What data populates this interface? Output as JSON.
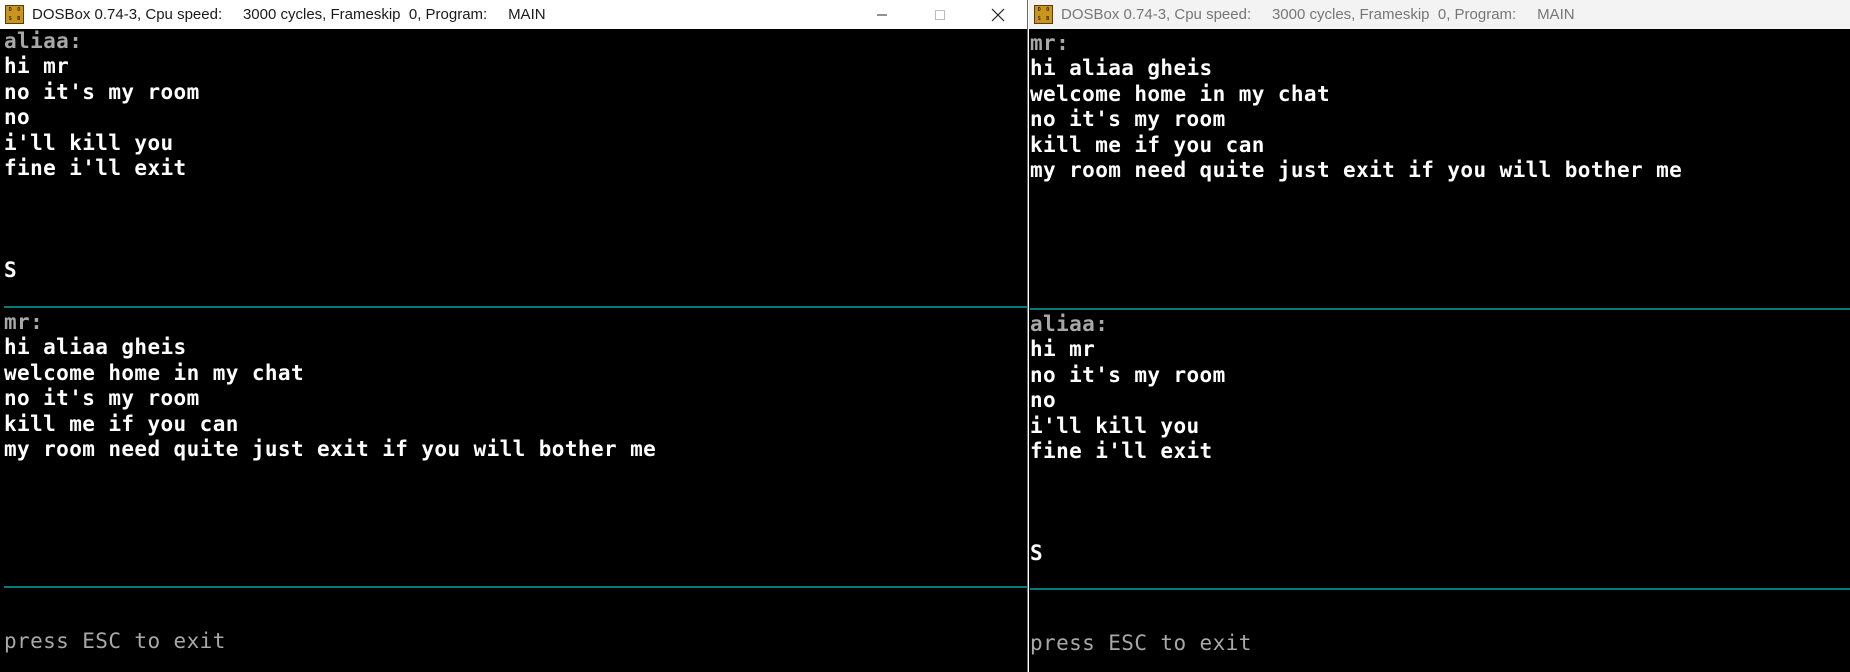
{
  "left_window": {
    "title": {
      "app": "DOSBox 0.74-3, Cpu speed:",
      "cycles": "3000 cycles, Frameskip  0, Program:",
      "program": "MAIN"
    },
    "top_pane": {
      "label": "aliaa:",
      "lines": [
        "hi mr",
        "no it's my room",
        "no",
        "i'll kill you",
        "fine i'll exit"
      ],
      "cursor": "S"
    },
    "bottom_pane": {
      "label": "mr:",
      "lines": [
        "hi aliaa gheis",
        "welcome home in my chat",
        "no it's my room",
        "kill me if you can",
        "my room need quite just exit if you will bother me"
      ]
    },
    "footer": "press ESC to exit"
  },
  "right_window": {
    "title": {
      "app": "DOSBox 0.74-3, Cpu speed:",
      "cycles": "3000 cycles, Frameskip  0, Program:",
      "program": "MAIN"
    },
    "top_pane": {
      "label": "mr:",
      "lines": [
        "hi aliaa gheis",
        "welcome home in my chat",
        "no it's my room",
        "kill me if you can",
        "my room need quite just exit if you will bother me"
      ]
    },
    "bottom_pane": {
      "label": "aliaa:",
      "lines": [
        "hi mr",
        "no it's my room",
        "no",
        "i'll kill you",
        "fine i'll exit"
      ],
      "cursor": "S"
    },
    "footer": "press ESC to exit"
  },
  "icons": {
    "app": "dosbox-icon",
    "minimize": "minimize-icon",
    "maximize": "maximize-icon",
    "close": "close-icon"
  },
  "colors": {
    "screen_bg": "#000000",
    "text": "#ffffff",
    "label_text": "#a8a8a8",
    "divider": "#007a7a"
  }
}
